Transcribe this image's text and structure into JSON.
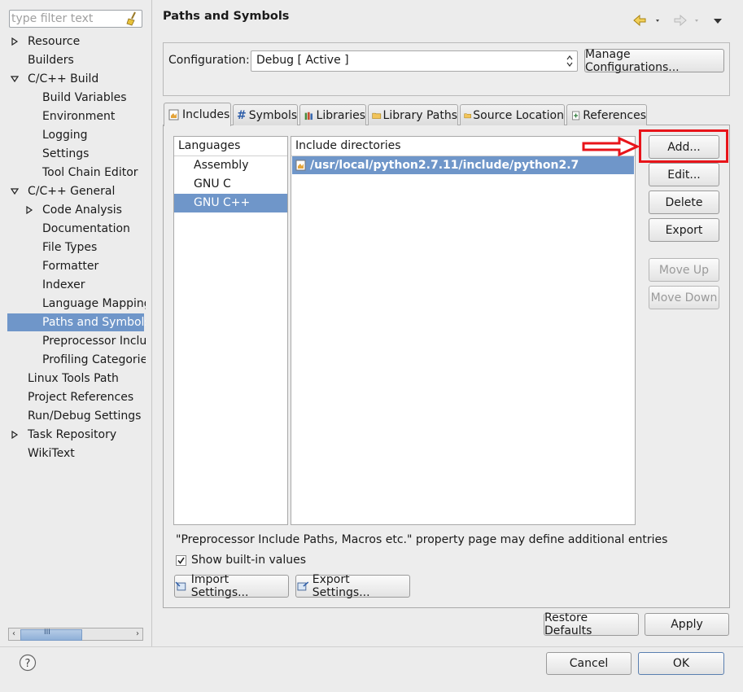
{
  "sidebar": {
    "filter_placeholder": "type filter text",
    "items": [
      {
        "label": "Resource",
        "level": 0,
        "toggle": "collapsed"
      },
      {
        "label": "Builders",
        "level": 0,
        "toggle": "none"
      },
      {
        "label": "C/C++ Build",
        "level": 0,
        "toggle": "expanded"
      },
      {
        "label": "Build Variables",
        "level": 1,
        "toggle": "none"
      },
      {
        "label": "Environment",
        "level": 1,
        "toggle": "none"
      },
      {
        "label": "Logging",
        "level": 1,
        "toggle": "none"
      },
      {
        "label": "Settings",
        "level": 1,
        "toggle": "none"
      },
      {
        "label": "Tool Chain Editor",
        "level": 1,
        "toggle": "none"
      },
      {
        "label": "C/C++ General",
        "level": 0,
        "toggle": "expanded"
      },
      {
        "label": "Code Analysis",
        "level": 1,
        "toggle": "collapsed"
      },
      {
        "label": "Documentation",
        "level": 1,
        "toggle": "none"
      },
      {
        "label": "File Types",
        "level": 1,
        "toggle": "none"
      },
      {
        "label": "Formatter",
        "level": 1,
        "toggle": "none"
      },
      {
        "label": "Indexer",
        "level": 1,
        "toggle": "none"
      },
      {
        "label": "Language Mapping",
        "level": 1,
        "toggle": "none"
      },
      {
        "label": "Paths and Symbols",
        "level": 1,
        "toggle": "none",
        "selected": true
      },
      {
        "label": "Preprocessor Includ",
        "level": 1,
        "toggle": "none"
      },
      {
        "label": "Profiling Categories",
        "level": 1,
        "toggle": "none"
      },
      {
        "label": "Linux Tools Path",
        "level": 0,
        "toggle": "none"
      },
      {
        "label": "Project References",
        "level": 0,
        "toggle": "none"
      },
      {
        "label": "Run/Debug Settings",
        "level": 0,
        "toggle": "none"
      },
      {
        "label": "Task Repository",
        "level": 0,
        "toggle": "collapsed"
      },
      {
        "label": "WikiText",
        "level": 0,
        "toggle": "none"
      }
    ],
    "scroll_thumb_glyph": "III"
  },
  "page": {
    "title": "Paths and Symbols",
    "configuration_label": "Configuration:",
    "configuration_value": "Debug  [ Active ]",
    "manage_button": "Manage Configurations..."
  },
  "tabs": [
    {
      "label": "Includes",
      "icon": "includes-icon",
      "active": true
    },
    {
      "label": "Symbols",
      "icon": "hash-icon",
      "active": false
    },
    {
      "label": "Libraries",
      "icon": "libraries-icon",
      "active": false
    },
    {
      "label": "Library Paths",
      "icon": "folder-icon",
      "active": false
    },
    {
      "label": "Source Location",
      "icon": "folder-icon",
      "active": false
    },
    {
      "label": "References",
      "icon": "references-icon",
      "active": false
    }
  ],
  "languages": {
    "header": "Languages",
    "items": [
      "Assembly",
      "GNU C",
      "GNU C++"
    ],
    "selected": "GNU C++"
  },
  "includes": {
    "header": "Include directories",
    "items": [
      "/usr/local/python2.7.11/include/python2.7"
    ]
  },
  "side_buttons": {
    "add": "Add...",
    "edit": "Edit...",
    "delete": "Delete",
    "export": "Export",
    "move_up": "Move Up",
    "move_down": "Move Down"
  },
  "note": "\"Preprocessor Include Paths, Macros etc.\" property page may define additional entries",
  "show_builtin": {
    "label": "Show built-in values",
    "checked": true
  },
  "import_button": "Import Settings...",
  "export_button": "Export Settings...",
  "restore_defaults": "Restore Defaults",
  "apply": "Apply",
  "cancel": "Cancel",
  "ok": "OK",
  "colors": {
    "selection": "#6f96c9",
    "annotation_red": "#e8141a"
  }
}
